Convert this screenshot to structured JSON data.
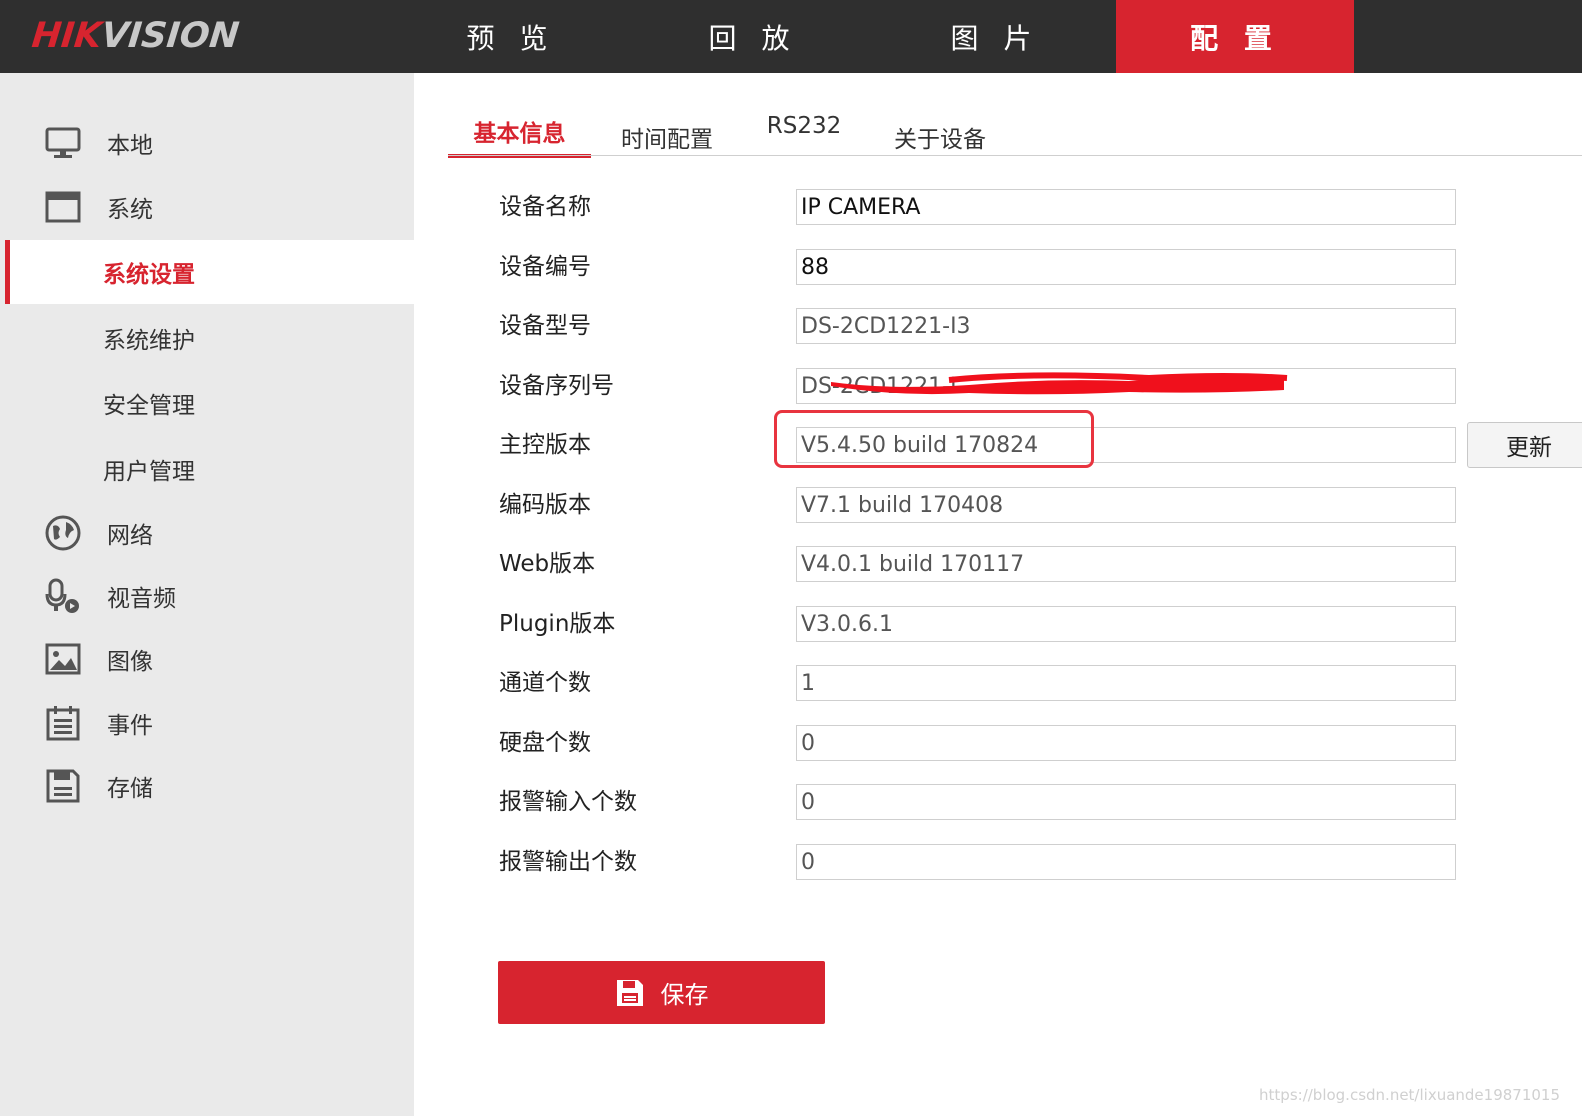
{
  "brand": {
    "logo_part1": "HIK",
    "logo_part2": "VISION",
    "accent_color": "#d7242f"
  },
  "top_nav": [
    "预 览",
    "回 放",
    "图 片",
    "配 置"
  ],
  "sidebar": {
    "local": "本地",
    "system": "系统",
    "system_settings": "系统设置",
    "system_maintenance": "系统维护",
    "security": "安全管理",
    "user_mgmt": "用户管理",
    "network": "网络",
    "audio_video": "视音频",
    "image": "图像",
    "event": "事件",
    "storage": "存储"
  },
  "tabs": [
    "基本信息",
    "时间配置",
    "RS232",
    "关于设备"
  ],
  "fields": {
    "device_name": {
      "label": "设备名称",
      "value": "IP CAMERA"
    },
    "device_no": {
      "label": "设备编号",
      "value": "88"
    },
    "model": {
      "label": "设备型号",
      "value": "DS-2CD1221-I3"
    },
    "serial": {
      "label": "设备序列号",
      "value": "DS-2CD1221-I"
    },
    "firmware": {
      "label": "主控版本",
      "value": "V5.4.50 build 170824"
    },
    "encoding": {
      "label": "编码版本",
      "value": "V7.1 build 170408"
    },
    "web": {
      "label": "Web版本",
      "value": "V4.0.1 build 170117"
    },
    "plugin": {
      "label": "Plugin版本",
      "value": "V3.0.6.1"
    },
    "channels": {
      "label": "通道个数",
      "value": "1"
    },
    "hdd": {
      "label": "硬盘个数",
      "value": "0"
    },
    "alarm_in": {
      "label": "报警输入个数",
      "value": "0"
    },
    "alarm_out": {
      "label": "报警输出个数",
      "value": "0"
    }
  },
  "buttons": {
    "update": "更新",
    "save": "保存"
  },
  "watermark": "https://blog.csdn.net/lixuande19871015"
}
